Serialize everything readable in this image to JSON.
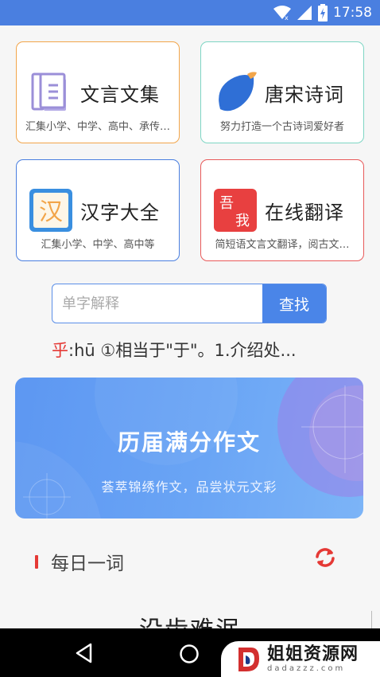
{
  "status_bar": {
    "time": "17:58",
    "icons": [
      "wifi-icon",
      "signal-icon",
      "battery-charging-icon"
    ]
  },
  "cards": [
    {
      "title": "文言文集",
      "subtitle": "汇集小学、中学、高中、承传…",
      "icon": "book-icon",
      "border_color": "#f2a54a"
    },
    {
      "title": "唐宋诗词",
      "subtitle": "努力打造一个古诗词爱好者",
      "icon": "leaf-icon",
      "border_color": "#7ed6c4"
    },
    {
      "title": "汉字大全",
      "subtitle": "汇集小学、中学、高中等",
      "icon": "han-character-icon",
      "icon_text": "汉",
      "border_color": "#4a7fe0"
    },
    {
      "title": "在线翻译",
      "subtitle": "简短语文言文翻译，阅古文…",
      "icon": "translate-icon",
      "icon_text_1": "吾",
      "icon_text_2": "我",
      "border_color": "#e85a5a"
    }
  ],
  "search": {
    "placeholder": "单字解释",
    "button_label": "查找"
  },
  "word_of_search": {
    "char": "乎",
    "definition": ":hū ①相当于\"于\"。1.介绍处..."
  },
  "banner": {
    "title": "历届满分作文",
    "subtitle": "荟萃锦绣作文，品尝状元文彩"
  },
  "daily": {
    "title": "每日一词",
    "word": "没齿难泯",
    "refresh_icon": "refresh-icon"
  },
  "nav": {
    "icons": [
      "back-icon",
      "home-icon"
    ]
  },
  "watermark": {
    "name": "姐姐资源网",
    "url": "dadazzz.com"
  },
  "colors": {
    "primary": "#4a85e8",
    "accent_red": "#e53935"
  }
}
